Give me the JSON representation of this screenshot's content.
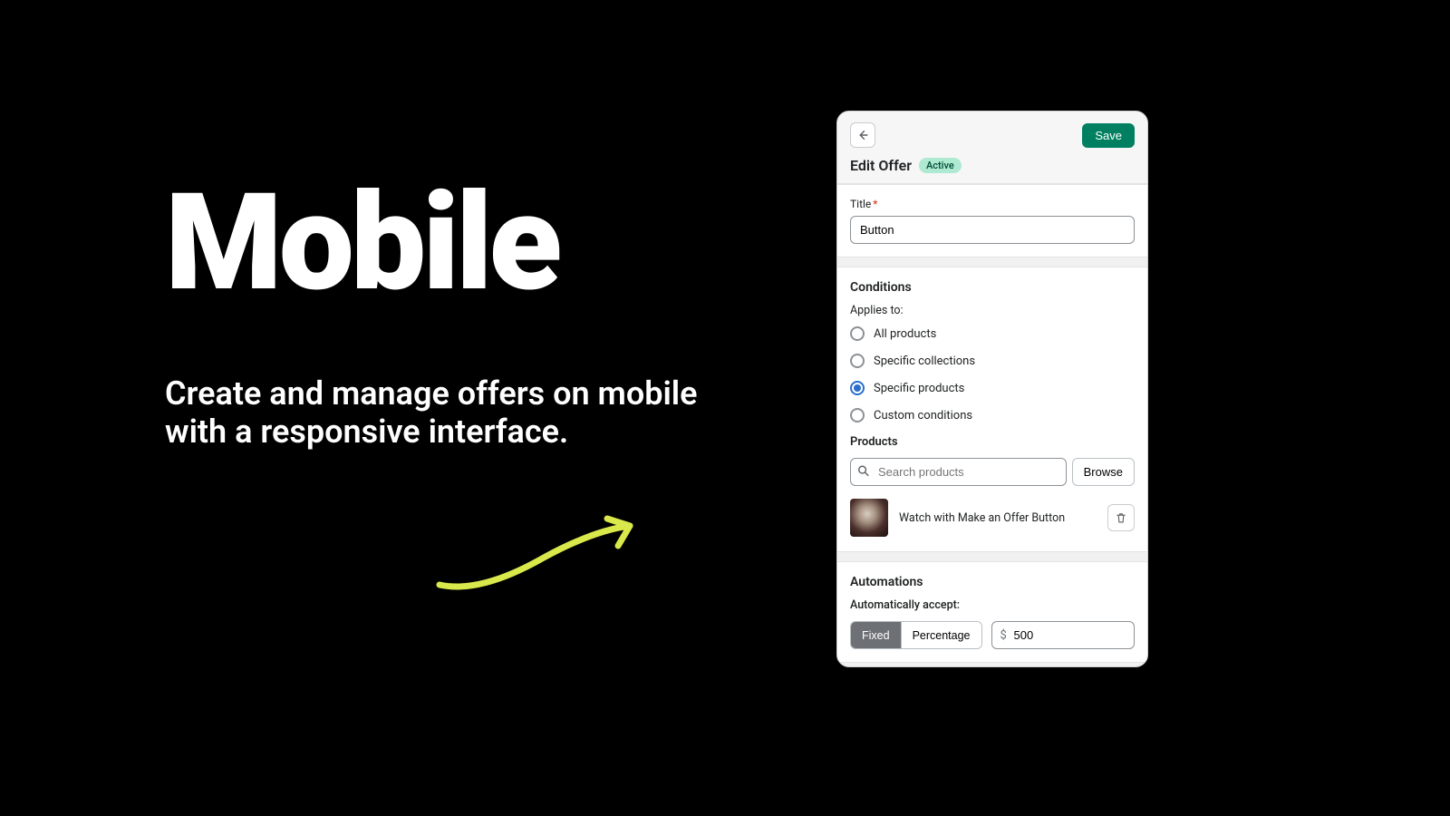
{
  "hero": {
    "title": "Mobile",
    "subtitle": "Create and manage offers on mobile with a responsive interface."
  },
  "app": {
    "save_label": "Save",
    "page_title": "Edit Offer",
    "status_badge": "Active",
    "title_section": {
      "label": "Title",
      "value": "Button"
    },
    "conditions": {
      "heading": "Conditions",
      "applies_to_label": "Applies to:",
      "options": [
        {
          "label": "All products",
          "selected": false
        },
        {
          "label": "Specific collections",
          "selected": false
        },
        {
          "label": "Specific products",
          "selected": true
        },
        {
          "label": "Custom conditions",
          "selected": false
        }
      ]
    },
    "products": {
      "heading": "Products",
      "search_placeholder": "Search products",
      "browse_label": "Browse",
      "items": [
        {
          "name": "Watch with Make an Offer Button"
        }
      ]
    },
    "automations": {
      "heading": "Automations",
      "auto_accept_label": "Automatically accept:",
      "segments": [
        {
          "label": "Fixed",
          "active": true
        },
        {
          "label": "Percentage",
          "active": false
        }
      ],
      "currency_prefix": "$",
      "amount": "500"
    }
  }
}
